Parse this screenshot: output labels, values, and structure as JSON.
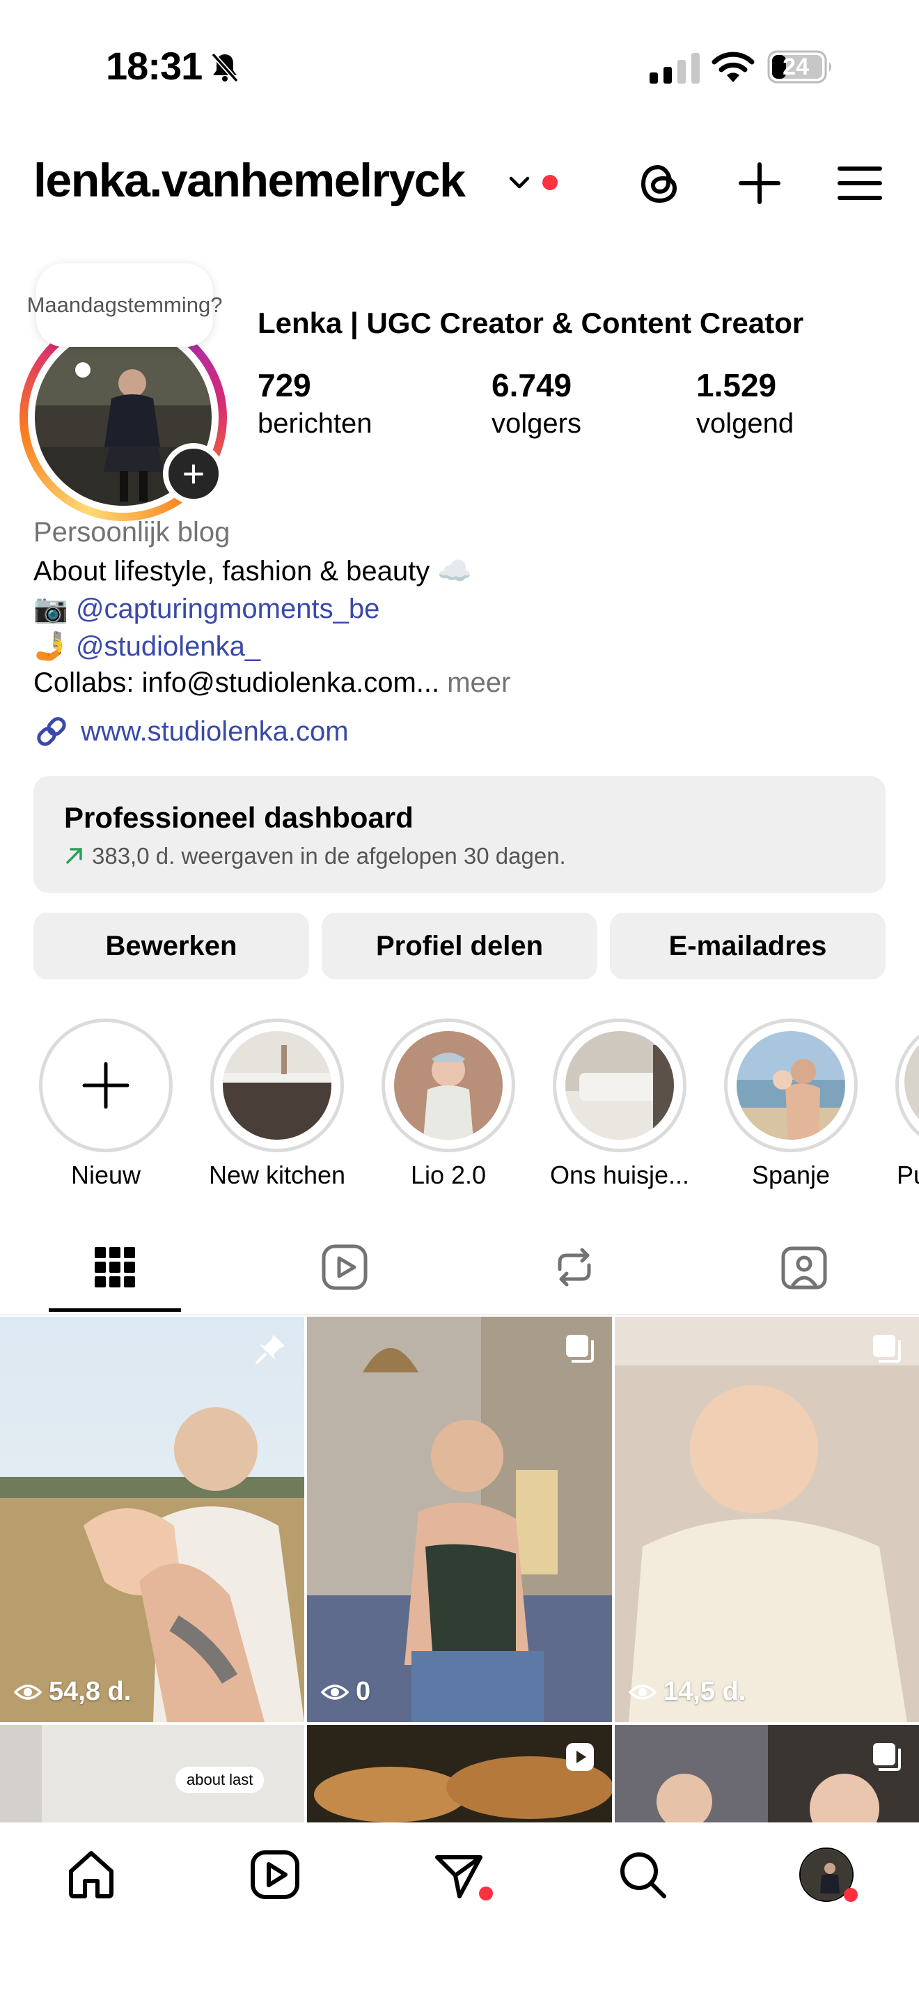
{
  "status_bar": {
    "time": "18:31",
    "battery": "24"
  },
  "header": {
    "username": "lenka.vanhemelryck"
  },
  "note": {
    "text": "Maandagstemming?"
  },
  "profile": {
    "name": "Lenka |  UGC Creator & Content Creator",
    "stats": [
      {
        "value": "729",
        "label": "berichten"
      },
      {
        "value": "6.749",
        "label": "volgers"
      },
      {
        "value": "1.529",
        "label": "volgend"
      }
    ],
    "category": "Persoonlijk blog",
    "bio_line1": "About lifestyle, fashion & beauty ☁️",
    "bio_link1_emoji": "📷",
    "bio_link1": "@capturingmoments_be",
    "bio_link2_emoji": "🤳",
    "bio_link2": "@studiolenka_",
    "bio_collab": "Collabs: info@studiolenka.com...",
    "bio_more": "meer",
    "website": "www.studiolenka.com"
  },
  "dashboard": {
    "title": "Professioneel dashboard",
    "subtitle": "383,0 d. weergaven in de afgelopen 30 dagen."
  },
  "buttons": {
    "edit": "Bewerken",
    "share": "Profiel delen",
    "email": "E-mailadres"
  },
  "highlights": [
    {
      "label": "Nieuw"
    },
    {
      "label": "New kitchen"
    },
    {
      "label": "Lio 2.0"
    },
    {
      "label": "Ons huisje..."
    },
    {
      "label": "Spanje"
    },
    {
      "label": "Pu"
    }
  ],
  "posts": [
    {
      "views": "54,8 d."
    },
    {
      "views": "0"
    },
    {
      "views": "14,5 d."
    }
  ],
  "post_row2_text": "about last",
  "colors": {
    "link": "#3949ab",
    "notification": "#ff3040",
    "trend_arrow": "#2e9e5b"
  }
}
